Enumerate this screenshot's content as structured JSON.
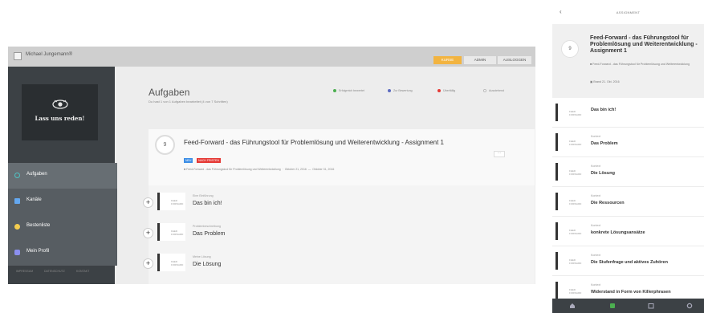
{
  "desktop": {
    "window_title": "Michael Junge­mann®",
    "top_buttons": [
      "KURSE",
      "ADMIN",
      "AUSLOGGEN"
    ],
    "logo_text": "Lass uns reden!",
    "nav": [
      {
        "label": "Aufgaben",
        "icon": "circle-icon",
        "color": "#4fc3c4",
        "active": true
      },
      {
        "label": "Kanäle",
        "icon": "chat-icon",
        "color": "#64a8f0",
        "active": false
      },
      {
        "label": "Bestenliste",
        "icon": "star-icon",
        "color": "#f4cd4f",
        "active": false
      },
      {
        "label": "Mein Profil",
        "icon": "user-icon",
        "color": "#8b8fef",
        "active": false
      }
    ],
    "footer_links": [
      "IMPRESSUM",
      "DATENSCHUTZ",
      "KONTAKT"
    ],
    "page_title": "Aufgaben",
    "page_subtitle": "Du hast 1 von 1 Aufgaben bearbeitet (4 von 7 Schritten)",
    "legend": [
      {
        "label": "Erfolgreich bewertet",
        "color": "#4caf50"
      },
      {
        "label": "Zur Bewertung",
        "color": "#5c6bc0"
      },
      {
        "label": "Überfällig",
        "color": "#e53935"
      },
      {
        "label": "Ausstehend",
        "color": "#ffffff"
      }
    ],
    "assignment": {
      "step": "9",
      "title": "Feed-Forward - das Führungstool für Problemlösung und Weiterentwicklung - Assignment 1",
      "badges": [
        {
          "text": "NEU",
          "color": "#3d8ee6"
        },
        {
          "text": "NACH FRISTEN",
          "color": "#e53935"
        }
      ],
      "meta_course": "Feed-Forward - das Führungstool für Problemlösung und Weiterentwicklung",
      "start": "Oktober 21, 2016",
      "end": "Oktober 31, 2016"
    },
    "tasks": [
      {
        "category": "Eine Einführung",
        "name": "Das bin ich!"
      },
      {
        "category": "Problembeschreibung",
        "name": "Das Problem"
      },
      {
        "category": "Meine Lösung",
        "name": "Die Lösung"
      }
    ]
  },
  "mobile": {
    "header_title": "ASSIGNMENT",
    "step": "9",
    "title": "Feed-Forward - das Führungstool für Problemlösung und Weiterentwicklung - Assignment 1",
    "meta": "Feed-Forward - das Führungstool für Problemlösung und Weiterentwicklung",
    "date": "Brand 21. Okt. 2016",
    "items": [
      {
        "category": "",
        "name": "Das bin ich!"
      },
      {
        "category": "Kontext",
        "name": "Das Problem"
      },
      {
        "category": "Kontext",
        "name": "Die Lösung"
      },
      {
        "category": "Kontext",
        "name": "Die Ressourcen"
      },
      {
        "category": "Kontext",
        "name": "konkrete Lösungsansätze"
      },
      {
        "category": "Kontext",
        "name": "Die Stufenfrage und aktives Zuhören"
      },
      {
        "category": "Kontext",
        "name": "Widerstand in Form von Killerphrasen"
      }
    ],
    "thumb_label": "FEED FORWARD",
    "bottom_nav": [
      "home-icon",
      "assignment-icon",
      "calendar-icon",
      "settings-icon"
    ]
  }
}
